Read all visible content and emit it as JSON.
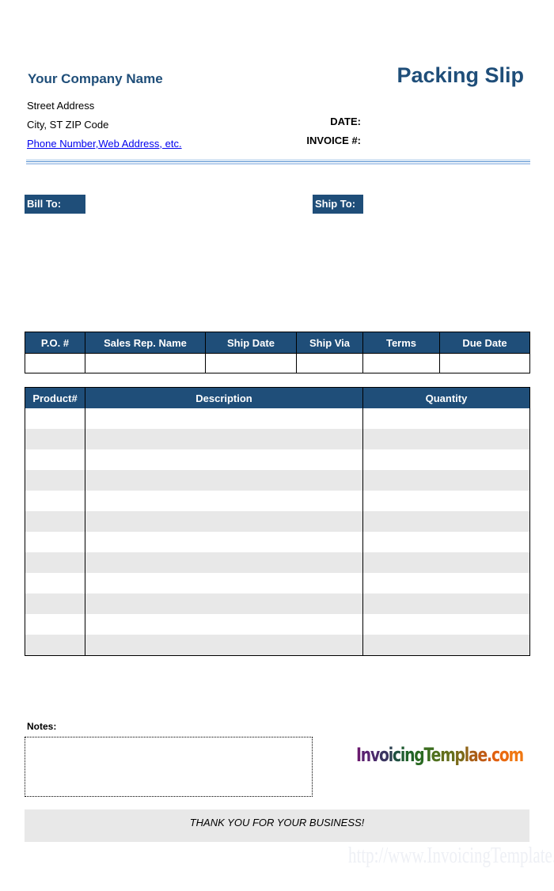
{
  "header": {
    "company_name": "Your Company Name",
    "doc_title": "Packing Slip",
    "street": "Street Address",
    "city_line": "City, ST  ZIP Code",
    "contact_link": "Phone Number,Web Address, etc.",
    "date_label": "DATE:",
    "date_value": "",
    "invoice_label": "INVOICE #:",
    "invoice_value": ""
  },
  "addresses": {
    "bill_to_label": "Bill To:",
    "ship_to_label": "Ship To:"
  },
  "order_meta": {
    "columns": [
      "P.O. #",
      "Sales Rep. Name",
      "Ship Date",
      "Ship Via",
      "Terms",
      "Due Date"
    ],
    "values": [
      "",
      "",
      "",
      "",
      "",
      ""
    ]
  },
  "items": {
    "columns": [
      "Product#",
      "Description",
      "Quantity"
    ],
    "rows": [
      [
        "",
        "",
        ""
      ],
      [
        "",
        "",
        ""
      ],
      [
        "",
        "",
        ""
      ],
      [
        "",
        "",
        ""
      ],
      [
        "",
        "",
        ""
      ],
      [
        "",
        "",
        ""
      ],
      [
        "",
        "",
        ""
      ],
      [
        "",
        "",
        ""
      ],
      [
        "",
        "",
        ""
      ],
      [
        "",
        "",
        ""
      ],
      [
        "",
        "",
        ""
      ],
      [
        "",
        "",
        ""
      ]
    ]
  },
  "notes": {
    "label": "Notes:",
    "value": ""
  },
  "logo": {
    "text": "InvoicingTemplae.com"
  },
  "footer": {
    "thanks": "THANK YOU FOR YOUR BUSINESS!",
    "watermark": "http://www.InvoicingTemplate.com"
  },
  "colors": {
    "accent": "#1f4e79",
    "stripe": "#e8e8e8",
    "link": "#0000ee"
  }
}
